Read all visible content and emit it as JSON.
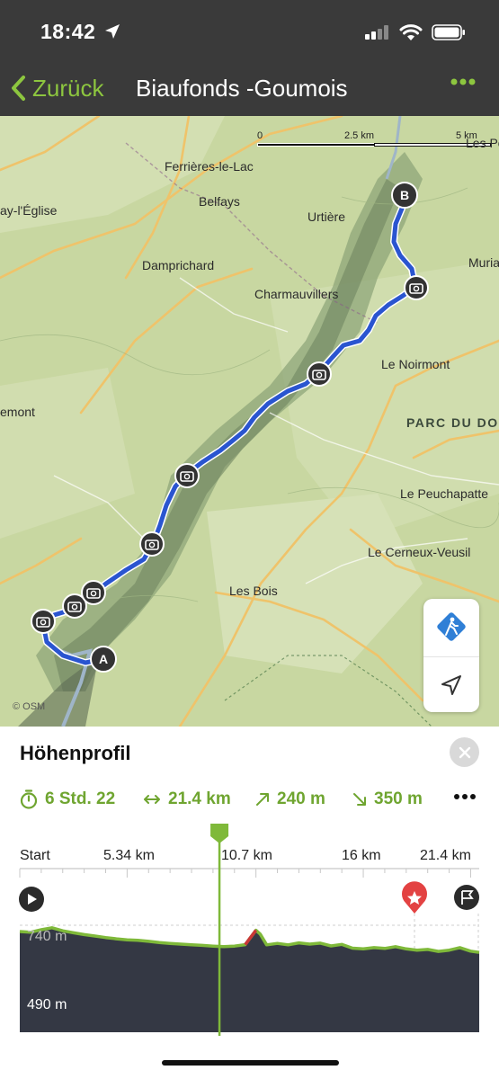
{
  "status": {
    "time": "18:42"
  },
  "nav": {
    "back_label": "Zurück",
    "title": "Biaufonds -Goumois"
  },
  "map": {
    "scale": [
      "0",
      "2.5 km",
      "5 km"
    ],
    "places": [
      {
        "id": "ferrieres",
        "label": "Ferrières-le-Lac"
      },
      {
        "id": "belfays",
        "label": "Belfays"
      },
      {
        "id": "urtiere",
        "label": "Urtière"
      },
      {
        "id": "damprichard",
        "label": "Damprichard"
      },
      {
        "id": "charmauvillers",
        "label": "Charmauvillers"
      },
      {
        "id": "noirmont",
        "label": "Le Noirmont"
      },
      {
        "id": "peuchapatte",
        "label": "Le Peuchapatte"
      },
      {
        "id": "cerneux",
        "label": "Le Cerneux-Veusil"
      },
      {
        "id": "lesbois",
        "label": "Les Bois"
      },
      {
        "id": "eglise",
        "label": "ay-l'Église"
      },
      {
        "id": "emont",
        "label": "emont"
      },
      {
        "id": "lespo",
        "label": "Les Po"
      },
      {
        "id": "muria",
        "label": "Muria"
      }
    ],
    "park_label": "PARC DU DO",
    "attribution": "© OSM",
    "start_marker": "A",
    "end_marker": "B"
  },
  "profile": {
    "title": "Höhenprofil",
    "stats": {
      "duration": "6 Std. 22",
      "distance": "21.4 km",
      "ascent": "240 m",
      "descent": "350 m"
    },
    "axis_labels": [
      "Start",
      "5.34 km",
      "10.7 km",
      "16 km",
      "21.4 km"
    ],
    "elevation_labels": [
      "740 m",
      "490 m"
    ]
  },
  "chart_data": {
    "type": "area",
    "title": "Höhenprofil",
    "xlabel": "",
    "ylabel": "",
    "x_unit": "km",
    "y_unit": "m",
    "xlim": [
      0,
      21.4
    ],
    "x_ticks": [
      "Start",
      "5.34 km",
      "10.7 km",
      "16 km",
      "21.4 km"
    ],
    "y_ticks": [
      "740 m",
      "490 m"
    ],
    "cursor_km": 9.3,
    "x": [
      0,
      0.5,
      1.0,
      1.5,
      2.0,
      2.5,
      3.0,
      3.5,
      4.0,
      4.5,
      5.0,
      5.5,
      6.0,
      6.5,
      7.0,
      7.5,
      8.0,
      8.5,
      9.0,
      9.5,
      10.0,
      10.5,
      11.0,
      11.2,
      11.5,
      12.0,
      12.5,
      13.0,
      13.5,
      14.0,
      14.5,
      15.0,
      15.5,
      16.0,
      16.5,
      17.0,
      17.5,
      18.0,
      18.5,
      19.0,
      19.5,
      20.0,
      20.5,
      21.0,
      21.4
    ],
    "y": [
      715,
      712,
      722,
      730,
      718,
      710,
      703,
      697,
      691,
      686,
      682,
      680,
      676,
      671,
      668,
      665,
      662,
      660,
      657,
      655,
      657,
      663,
      720,
      705,
      662,
      668,
      662,
      670,
      665,
      669,
      658,
      664,
      649,
      646,
      651,
      648,
      655,
      646,
      641,
      644,
      636,
      641,
      651,
      637,
      632
    ]
  }
}
